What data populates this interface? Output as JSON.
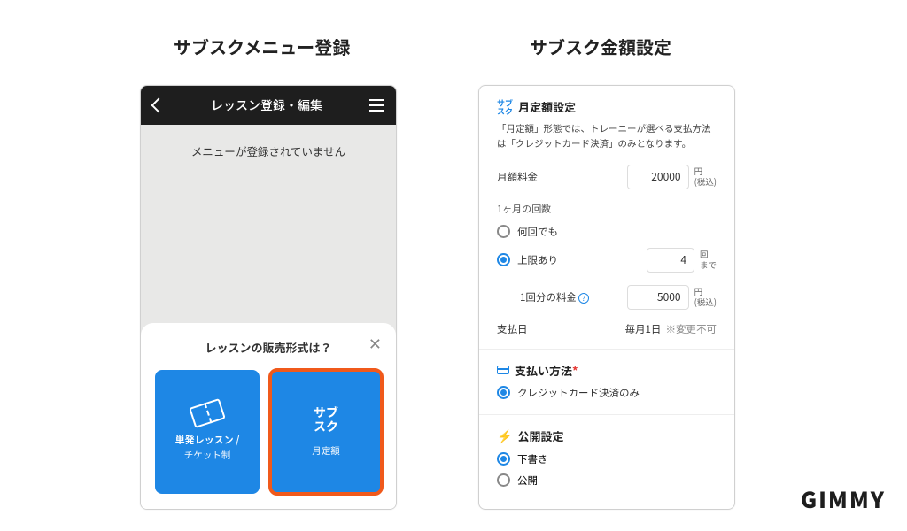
{
  "brand": "GIMMY",
  "titles": {
    "left": "サブスクメニュー登録",
    "right": "サブスク金額設定"
  },
  "left": {
    "header": "レッスン登録・編集",
    "empty": "メニューが登録されていません",
    "sheet": {
      "title": "レッスンの販売形式は？",
      "options": [
        {
          "line1": "単発レッスン /",
          "line2": "チケット制"
        },
        {
          "icon1": "サブ",
          "icon2": "スク",
          "line2": "月定額"
        }
      ]
    }
  },
  "right": {
    "sec1": {
      "badge1": "サブ",
      "badge2": "スク",
      "title": "月定額設定",
      "hint": "「月定額」形態では、トレーニーが選べる支払方法は「クレジットカード決済」のみとなります。",
      "fee_label": "月額料金",
      "fee_value": "20000",
      "fee_unit1": "円",
      "fee_unit2": "(税込)",
      "count_label": "1ヶ月の回数",
      "opt_any": "何回でも",
      "opt_limit": "上限あり",
      "limit_value": "4",
      "limit_unit1": "回",
      "limit_unit2": "まで",
      "perfee_label": "1回分の料金",
      "perfee_value": "5000",
      "perfee_unit1": "円",
      "perfee_unit2": "(税込)",
      "payday_label": "支払日",
      "payday_value": "毎月1日",
      "payday_note": "※変更不可"
    },
    "sec2": {
      "title": "支払い方法",
      "opt": "クレジットカード決済のみ"
    },
    "sec3": {
      "title": "公開設定",
      "draft": "下書き",
      "publish": "公開"
    }
  }
}
